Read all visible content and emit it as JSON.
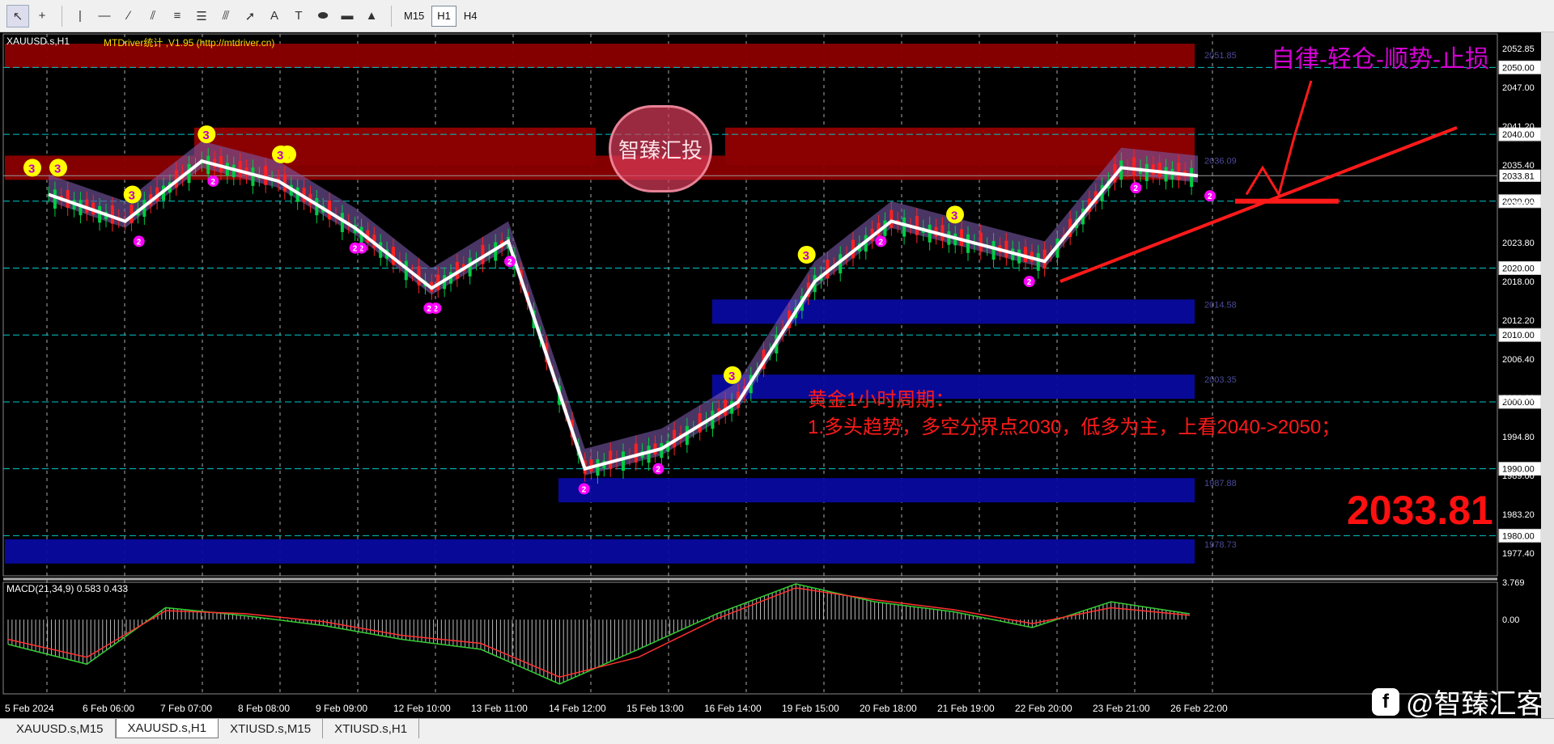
{
  "toolbar": {
    "icons": [
      "cursor-icon",
      "crosshair-icon",
      "vertical-line-icon",
      "horizontal-line-icon",
      "trendline-icon",
      "equidistant-channel-icon",
      "fibonacci-retracement-icon",
      "fibonacci-fan-icon",
      "gann-fan-icon",
      "arrow-icon",
      "text-icon",
      "text-label-icon",
      "ellipse-icon",
      "rectangle-icon",
      "triangle-icon"
    ],
    "text_tool": "A",
    "label_tool": "T",
    "timeframes": [
      "M15",
      "H1",
      "H4"
    ],
    "active_timeframe": "H1"
  },
  "chart": {
    "symbol_title": "XAUUSD.s,H1",
    "indicator_title": "MTDriver统计 ,V1.95 (http://mtdriver.cn)",
    "slogan": "自律-轻仓-顺势-止损",
    "analysis_title": "黄金1小时周期：",
    "analysis_line": "1.多头趋势，多空分界点2030，低多为主，上看2040->2050；",
    "big_price": "2033.81",
    "stamp_text": "智臻汇投",
    "watermark_text": "@智臻汇客",
    "watermark_logo": "f",
    "macd_label": "MACD(21,34,9) 0.583 0.433",
    "current_price": "2033.81",
    "colors": {
      "background": "#000000",
      "bull_candle": "#00cc44",
      "bear_candle": "#ff2020",
      "supply_zone": "#8b0000",
      "demand_zone": "#0a0aa0",
      "level_line": "#00c8c8",
      "annotation": "#ff1a1a",
      "slogan": "#d400d4",
      "wave_label": "#ffff00"
    }
  },
  "chart_data": [
    {
      "type": "line",
      "title": "XAUUSD.s,H1",
      "ylim": [
        1974,
        2055
      ],
      "price_scale_ticks": [
        "2052.85",
        "2047.00",
        "2041.20",
        "2035.40",
        "2029.60",
        "2023.80",
        "2018.00",
        "2012.20",
        "2006.40",
        "2000.60",
        "1994.80",
        "1989.00",
        "1983.20",
        "1977.40"
      ],
      "level_labels": [
        "2050.00",
        "2040.00",
        "2030.00",
        "2020.00",
        "2010.00",
        "2000.00",
        "1990.00",
        "1980.00"
      ],
      "zone_labels": [
        "2051.85",
        "2036.09",
        "2014.58",
        "2003.35",
        "1987.88",
        "1978.73"
      ],
      "x_tick_labels": [
        "5 Feb 2024",
        "6 Feb 06:00",
        "7 Feb 07:00",
        "8 Feb 08:00",
        "9 Feb 09:00",
        "12 Feb 10:00",
        "13 Feb 11:00",
        "14 Feb 12:00",
        "15 Feb 13:00",
        "16 Feb 14:00",
        "19 Feb 15:00",
        "20 Feb 18:00",
        "21 Feb 19:00",
        "22 Feb 20:00",
        "23 Feb 21:00",
        "26 Feb 22:00"
      ],
      "series": [
        {
          "name": "price",
          "x": [
            "5 Feb 2024",
            "6 Feb 06:00",
            "7 Feb 07:00",
            "8 Feb 08:00",
            "9 Feb 09:00",
            "12 Feb 10:00",
            "13 Feb 11:00",
            "14 Feb 12:00",
            "15 Feb 13:00",
            "16 Feb 14:00",
            "19 Feb 15:00",
            "20 Feb 18:00",
            "21 Feb 19:00",
            "22 Feb 20:00",
            "23 Feb 21:00",
            "26 Feb 22:00"
          ],
          "values": [
            2031,
            2027,
            2036,
            2033,
            2026,
            2017,
            2024,
            1990,
            1993,
            2000,
            2018,
            2027,
            2024,
            2021,
            2035,
            2033.8
          ]
        }
      ],
      "wave_labels": [
        "3",
        "2",
        "2",
        "3",
        "2",
        "2",
        "2",
        "2",
        "2",
        "3",
        "3",
        "2",
        "3",
        "2",
        "2",
        "2",
        "3",
        "3",
        "3",
        "3",
        "2",
        "2"
      ]
    },
    {
      "type": "bar",
      "title": "MACD(21,34,9) 0.583 0.433",
      "ylim": [
        -7.5,
        3.769
      ],
      "scale_labels": [
        "3.769",
        "0.00"
      ],
      "categories": [
        "5 Feb 2024",
        "6 Feb 06:00",
        "7 Feb 07:00",
        "8 Feb 08:00",
        "9 Feb 09:00",
        "12 Feb 10:00",
        "13 Feb 11:00",
        "14 Feb 12:00",
        "15 Feb 13:00",
        "16 Feb 14:00",
        "19 Feb 15:00",
        "20 Feb 18:00",
        "21 Feb 19:00",
        "22 Feb 20:00",
        "23 Feb 21:00",
        "26 Feb 22:00"
      ],
      "series": [
        {
          "name": "MACD",
          "values": [
            -2.5,
            -4.5,
            1.2,
            0.4,
            -0.6,
            -2.0,
            -3.0,
            -6.5,
            -3.0,
            0.6,
            3.6,
            1.8,
            0.8,
            -0.8,
            1.8,
            0.583
          ]
        },
        {
          "name": "signal",
          "values": [
            -2.0,
            -3.8,
            0.9,
            0.6,
            -0.2,
            -1.6,
            -2.4,
            -5.8,
            -3.8,
            0.1,
            3.2,
            2.0,
            1.0,
            -0.4,
            1.2,
            0.433
          ]
        }
      ]
    }
  ],
  "tabs": [
    "XAUUSD.s,M15",
    "XAUUSD.s,H1",
    "XTIUSD.s,M15",
    "XTIUSD.s,H1"
  ],
  "active_tab": "XAUUSD.s,H1"
}
